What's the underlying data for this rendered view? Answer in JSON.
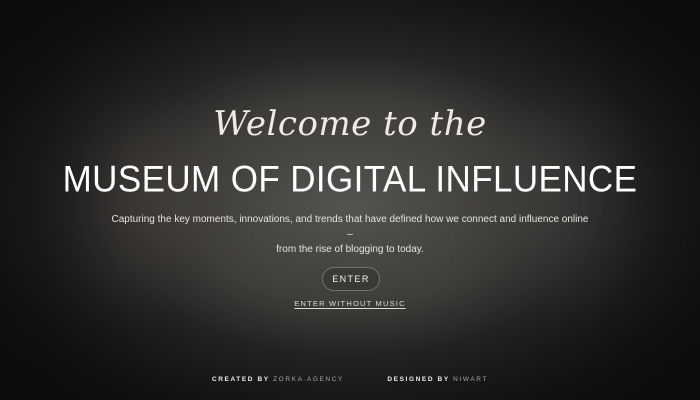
{
  "hero": {
    "welcome": "Welcome to the",
    "title": "MUSEUM OF DIGITAL INFLUENCE",
    "subtitle_line1": "Capturing the key moments, innovations, and trends that have defined how we connect and influence online –",
    "subtitle_line2": "from the rise of blogging to today."
  },
  "actions": {
    "enter_label": "ENTER",
    "enter_without_music_label": "ENTER WITHOUT MUSIC"
  },
  "footer": {
    "created_by_label": "CREATED BY",
    "created_by_value": "ZORKA.AGENCY",
    "designed_by_label": "DESIGNED BY",
    "designed_by_value": "NIWART"
  },
  "colors": {
    "background": "#1a1a1a",
    "text": "#f2f0ec",
    "muted": "#a9a7a2"
  }
}
